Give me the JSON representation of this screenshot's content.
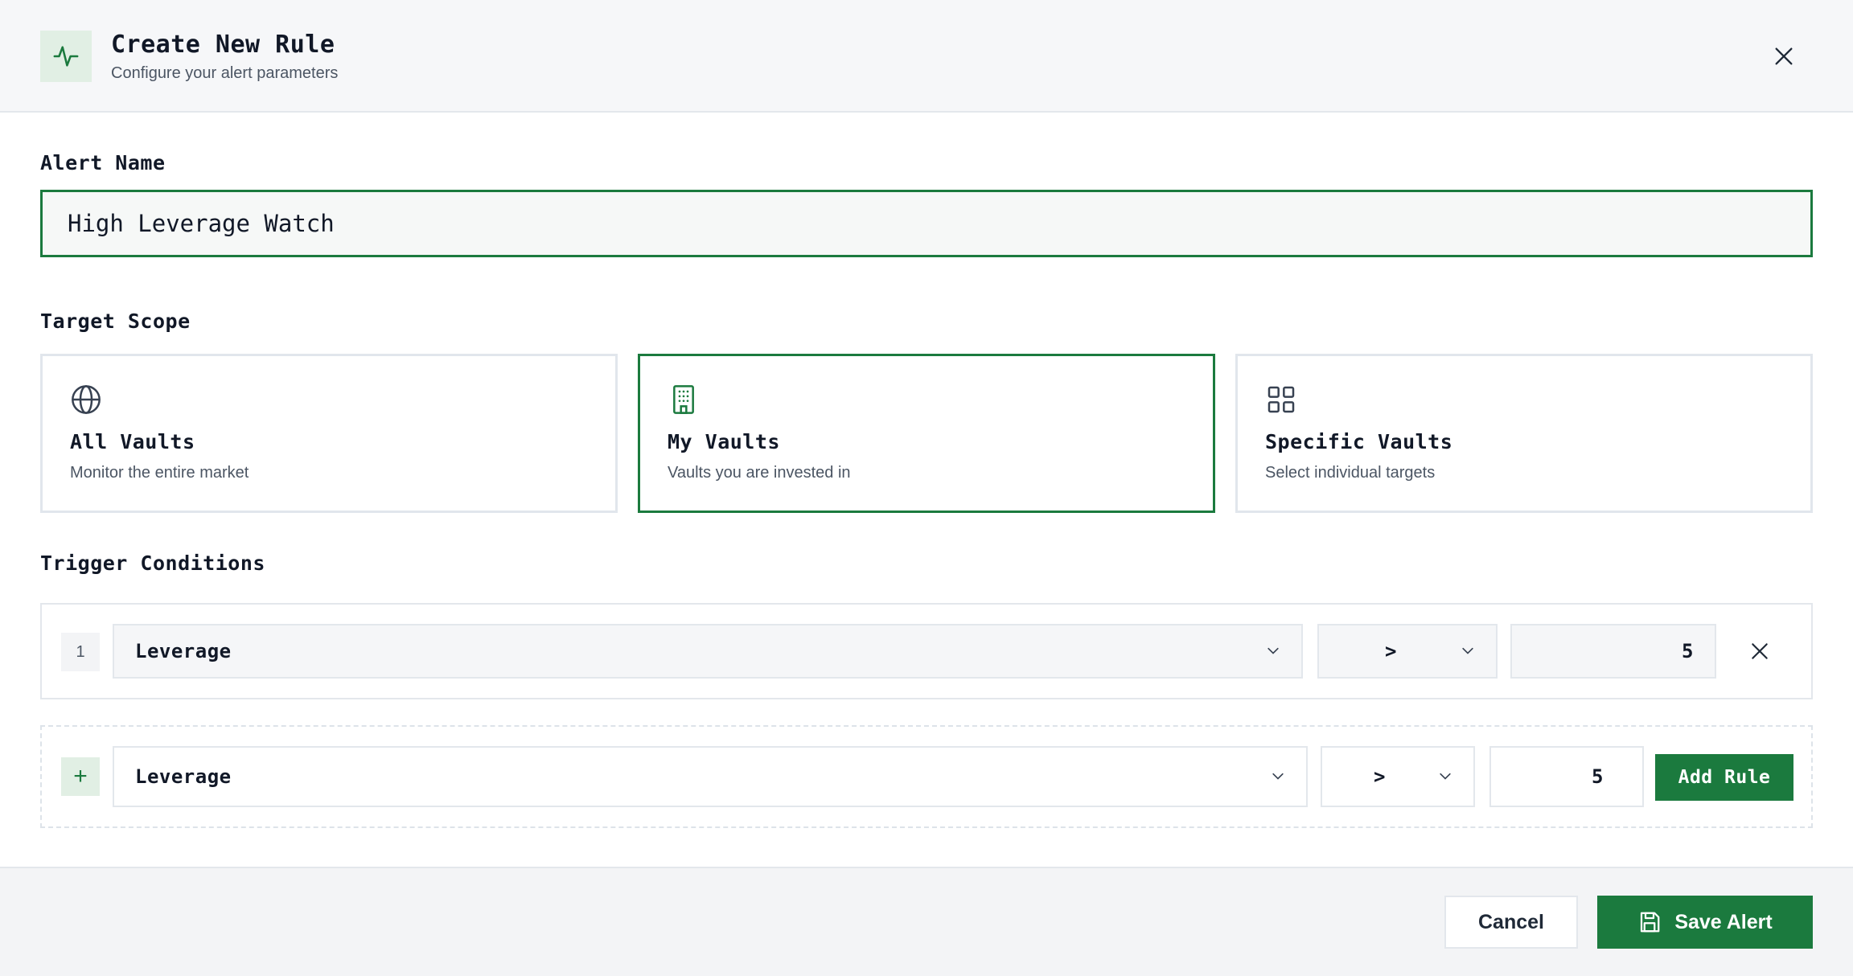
{
  "header": {
    "title": "Create New Rule",
    "subtitle": "Configure your alert parameters",
    "icon": "activity-icon",
    "accent_color": "#1b7a3e"
  },
  "alert_name": {
    "label": "Alert Name",
    "value": "High Leverage Watch"
  },
  "target_scope": {
    "label": "Target Scope",
    "options": [
      {
        "title": "All Vaults",
        "description": "Monitor the entire market",
        "icon": "globe-icon",
        "selected": false
      },
      {
        "title": "My Vaults",
        "description": "Vaults you are invested in",
        "icon": "building-icon",
        "selected": true
      },
      {
        "title": "Specific Vaults",
        "description": "Select individual targets",
        "icon": "grid-icon",
        "selected": false
      }
    ]
  },
  "trigger_conditions": {
    "label": "Trigger Conditions",
    "rules": [
      {
        "index": "1",
        "metric": "Leverage",
        "operator": ">",
        "value": "5"
      }
    ],
    "new_rule": {
      "add_symbol": "+",
      "metric": "Leverage",
      "operator": ">",
      "value": "5",
      "button_label": "Add Rule"
    }
  },
  "footer": {
    "cancel_label": "Cancel",
    "save_label": "Save Alert"
  }
}
